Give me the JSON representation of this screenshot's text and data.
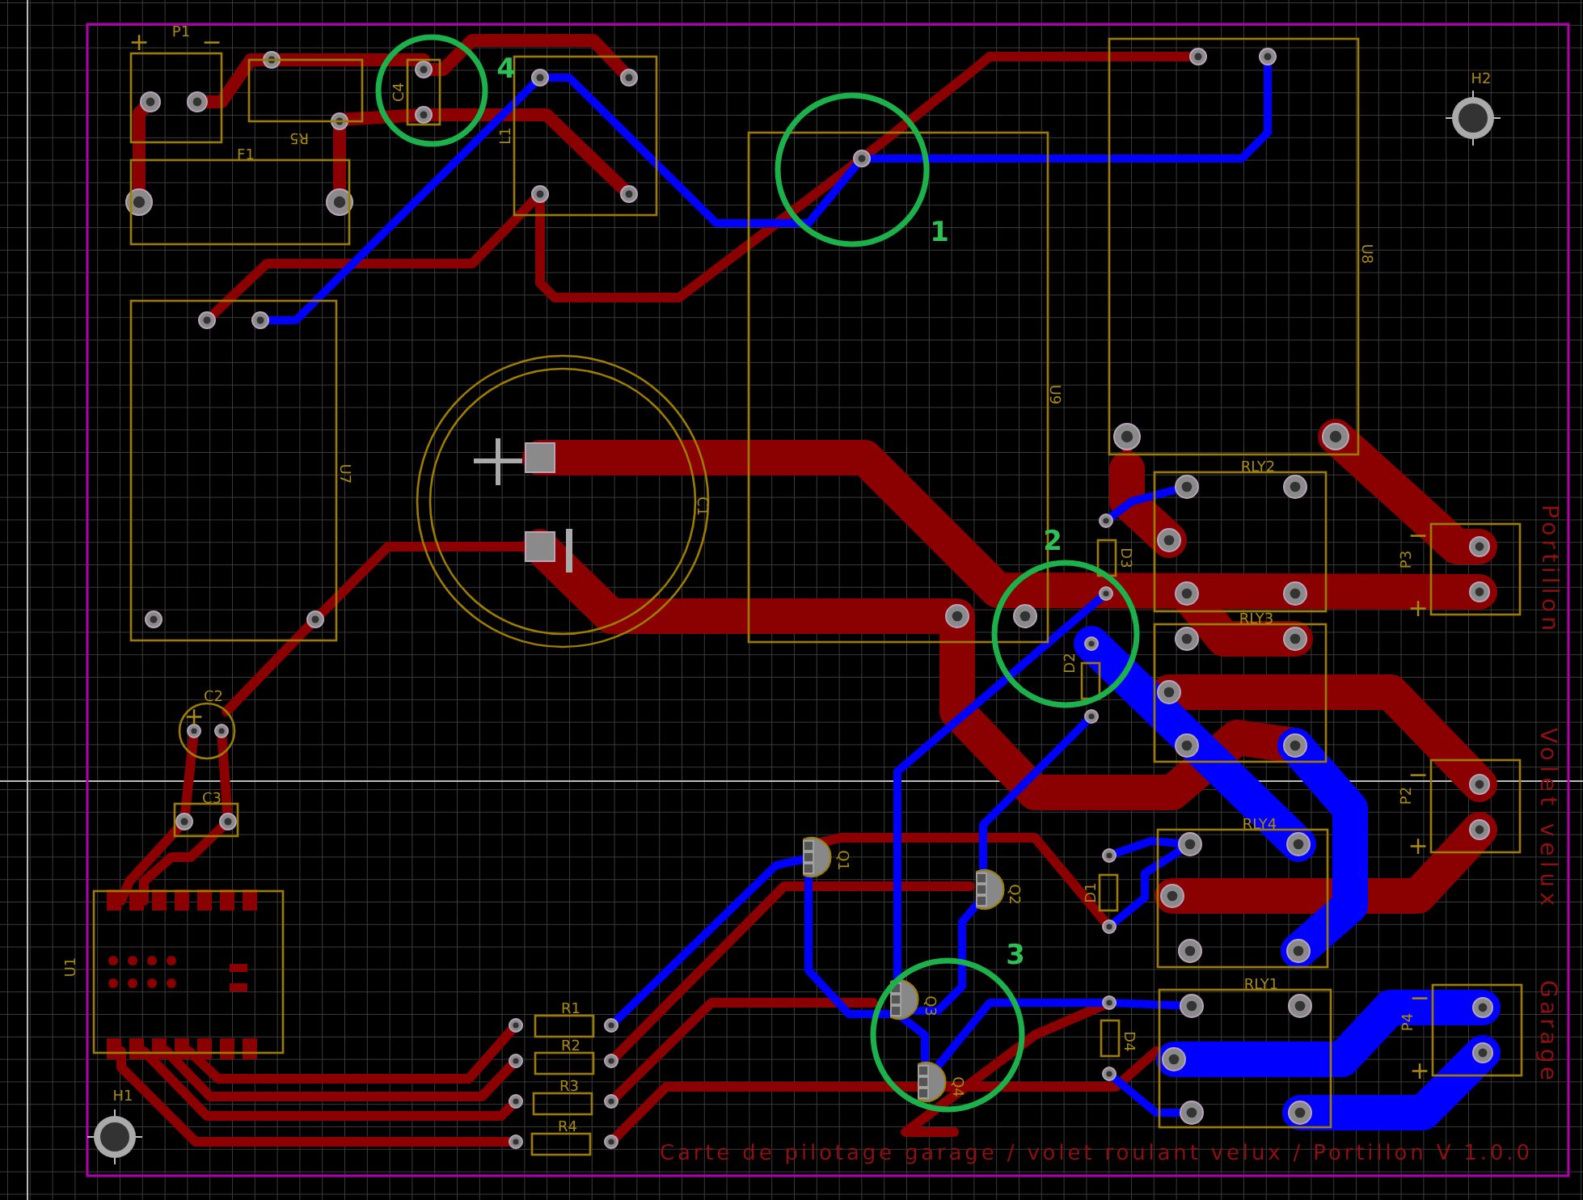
{
  "board": {
    "title": "Carte de pilotage garage / volet roulant velux / Portillon V 1.0.0"
  },
  "components": [
    {
      "ref": "P1"
    },
    {
      "ref": "R5"
    },
    {
      "ref": "C4"
    },
    {
      "ref": "L1"
    },
    {
      "ref": "F1"
    },
    {
      "ref": "U9"
    },
    {
      "ref": "U8"
    },
    {
      "ref": "H2"
    },
    {
      "ref": "U7"
    },
    {
      "ref": "C1"
    },
    {
      "ref": "C2"
    },
    {
      "ref": "C3"
    },
    {
      "ref": "U1"
    },
    {
      "ref": "H1"
    },
    {
      "ref": "R1"
    },
    {
      "ref": "R2"
    },
    {
      "ref": "R3"
    },
    {
      "ref": "R4"
    },
    {
      "ref": "Q1"
    },
    {
      "ref": "Q2"
    },
    {
      "ref": "Q3"
    },
    {
      "ref": "Q4"
    },
    {
      "ref": "D3"
    },
    {
      "ref": "D2"
    },
    {
      "ref": "D1"
    },
    {
      "ref": "D4"
    },
    {
      "ref": "RLY2"
    },
    {
      "ref": "RLY3"
    },
    {
      "ref": "RLY4"
    },
    {
      "ref": "RLY1"
    },
    {
      "ref": "P3"
    },
    {
      "ref": "P2"
    },
    {
      "ref": "P4"
    }
  ],
  "polarity_marks": [
    {
      "text": "+"
    },
    {
      "text": "−"
    },
    {
      "text": "−"
    },
    {
      "text": "+"
    },
    {
      "text": "−"
    },
    {
      "text": "+"
    },
    {
      "text": "−"
    },
    {
      "text": "+"
    },
    {
      "text": "+"
    }
  ],
  "connector_labels": [
    {
      "text": "Portillon"
    },
    {
      "text": "Volet velux"
    },
    {
      "text": "Garage"
    }
  ],
  "callouts": [
    {
      "number": "1"
    },
    {
      "number": "2"
    },
    {
      "number": "3"
    },
    {
      "number": "4"
    }
  ]
}
